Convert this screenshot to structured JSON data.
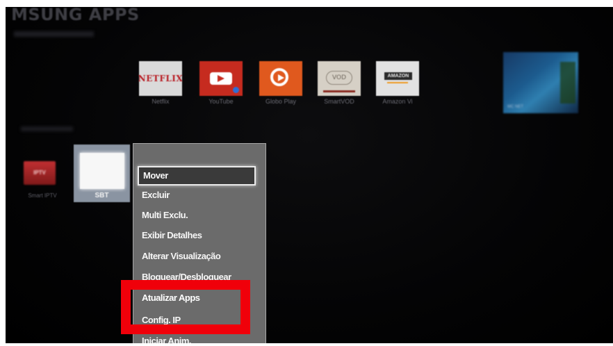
{
  "header": {
    "title": "MSUNG APPS"
  },
  "apps_row": [
    {
      "id": "netflix",
      "label": "Netflix",
      "logo_text": "NETFLIX",
      "icon": "netflix-logo-icon",
      "color": "#b81d24"
    },
    {
      "id": "youtube",
      "label": "YouTube",
      "icon": "youtube-logo-icon",
      "color": "#c62b1f"
    },
    {
      "id": "globoplay",
      "label": "Globo Play",
      "icon": "globo-play-logo-icon",
      "color": "#e0591e"
    },
    {
      "id": "smartvod",
      "label": "SmartVOD",
      "logo_text": "VOD",
      "icon": "smartvod-logo-icon"
    },
    {
      "id": "amazon",
      "label": "Amazon Vi",
      "logo_text": "AMAZON",
      "icon": "amazon-logo-icon"
    }
  ],
  "featured": {
    "label": "MC NET"
  },
  "my_apps": [
    {
      "id": "smartiptv",
      "label": "Smart IPTV",
      "logo_text": "IPTV",
      "icon": "smart-iptv-logo-icon"
    },
    {
      "id": "sbt",
      "label": "SBT",
      "selected": true
    }
  ],
  "context_menu": {
    "items": [
      {
        "label": "Mover",
        "selected": true
      },
      {
        "label": "Excluir"
      },
      {
        "label": "Multi Exclu."
      },
      {
        "label": "Exibir Detalhes"
      },
      {
        "label": "Alterar Visualização"
      },
      {
        "label": "Bloquear/Desbloquear"
      },
      {
        "label": "Atualizar Apps"
      },
      {
        "label": "Config. IP"
      },
      {
        "label": "Iniciar Anim."
      }
    ]
  },
  "annotation": {
    "color": "#f0000a"
  }
}
